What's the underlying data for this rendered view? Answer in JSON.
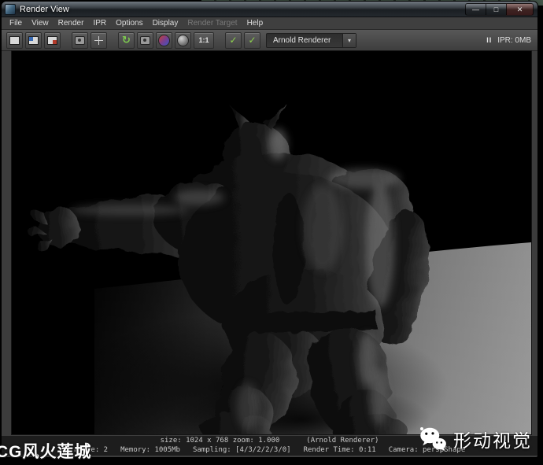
{
  "window": {
    "title": "Render View",
    "controls": {
      "minimize": "—",
      "maximize": "□",
      "close": "✕"
    }
  },
  "menu": {
    "items": [
      {
        "label": "File"
      },
      {
        "label": "View"
      },
      {
        "label": "Render"
      },
      {
        "label": "IPR"
      },
      {
        "label": "Options"
      },
      {
        "label": "Display"
      },
      {
        "label": "Render Target"
      },
      {
        "label": "Help"
      }
    ]
  },
  "toolbar": {
    "icons": [
      {
        "name": "save-image-icon"
      },
      {
        "name": "keep-image-icon"
      },
      {
        "name": "remove-image-icon"
      },
      {
        "name": "open-render-settings-icon"
      },
      {
        "name": "render-region-icon"
      },
      {
        "name": "refresh-icon",
        "glyph": "↻"
      },
      {
        "name": "snapshot-icon"
      },
      {
        "name": "rgb-channels-icon"
      },
      {
        "name": "alpha-channel-icon"
      },
      {
        "name": "zoom-one-to-one-icon",
        "label": "1:1"
      },
      {
        "name": "ipr-toggle-icon",
        "glyph": "✓"
      },
      {
        "name": "region-toggle-icon",
        "glyph": "✓"
      }
    ],
    "renderer_dropdown": "Arnold Renderer",
    "dropdown_arrow": "▾",
    "pause_label": "II",
    "ipr_status": "IPR: 0MB"
  },
  "status": {
    "size_zoom": "size: 1024 x 768 zoom: 1.000",
    "renderer": "(Arnold Renderer)",
    "frame": "Frame: 2",
    "memory": "Memory: 1005Mb",
    "sampling": "Sampling: [4/3/2/2/3/0]",
    "render_time": "Render Time: 0:11",
    "camera": "Camera: perspShape"
  },
  "watermarks": {
    "bottom_left": "CG风火莲城",
    "bottom_right": "形动视觉"
  },
  "colors": {
    "floor_gray": "#8f8f8f",
    "viewport_bg": "#000000",
    "toolbar_green": "#8ed24e"
  }
}
